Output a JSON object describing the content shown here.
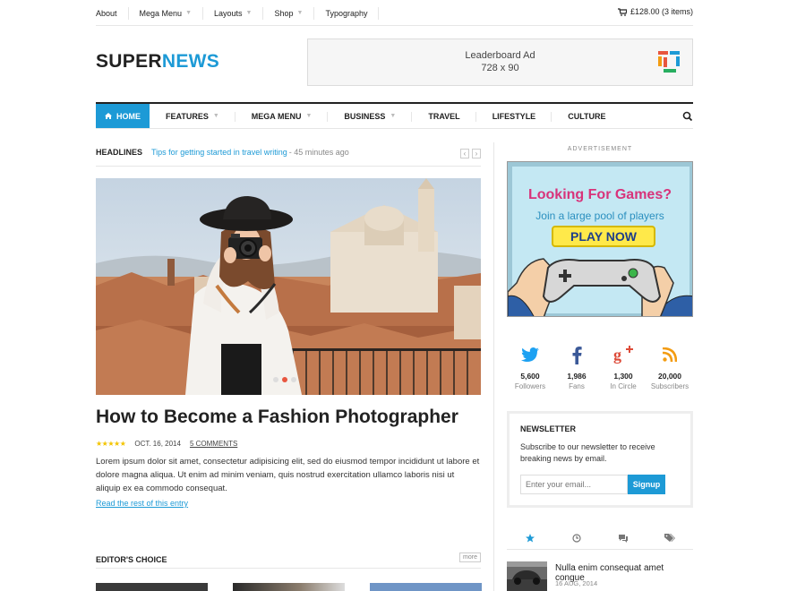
{
  "topbar": {
    "items": [
      {
        "label": "About",
        "dropdown": false
      },
      {
        "label": "Mega Menu",
        "dropdown": true
      },
      {
        "label": "Layouts",
        "dropdown": true
      },
      {
        "label": "Shop",
        "dropdown": true
      },
      {
        "label": "Typography",
        "dropdown": false
      }
    ],
    "cart": "£128.00 (3 items)"
  },
  "header": {
    "logo_part1": "SUPER",
    "logo_part2": "NEWS",
    "leaderboard_line1": "Leaderboard Ad",
    "leaderboard_line2": "728 x 90"
  },
  "nav": {
    "home": "HOME",
    "items": [
      {
        "label": "FEATURES",
        "dropdown": true
      },
      {
        "label": "MEGA MENU",
        "dropdown": true
      },
      {
        "label": "BUSINESS",
        "dropdown": true
      },
      {
        "label": "TRAVEL",
        "dropdown": false
      },
      {
        "label": "LIFESTYLE",
        "dropdown": false
      },
      {
        "label": "CULTURE",
        "dropdown": false
      }
    ]
  },
  "headlines": {
    "title": "HEADLINES",
    "link": "Tips for getting started in travel writing",
    "time": "- 45 minutes ago"
  },
  "article": {
    "title": "How to Become a Fashion Photographer",
    "rating": 5,
    "stars": "★★★★★",
    "date": "OCT. 16, 2014",
    "comments": "5 COMMENTS",
    "excerpt": "Lorem ipsum dolor sit amet, consectetur adipisicing elit, sed do eiusmod tempor incididunt ut labore et dolore magna aliqua. Ut enim ad minim veniam, quis nostrud exercitation ullamco laboris nisi ut aliquip ex ea commodo consequat.",
    "read_more": "Read the rest of this entry",
    "slide_active": 2
  },
  "editors_choice": {
    "title": "EDITOR'S CHOICE",
    "more": "more"
  },
  "sidebar": {
    "advert_label": "ADVERTISEMENT",
    "game_ad": {
      "headline": "Looking For Games?",
      "subline": "Join a large pool of players",
      "button": "PLAY NOW"
    },
    "social": [
      {
        "icon": "twitter-icon",
        "count": "5,600",
        "label": "Followers",
        "color": "#1da1f2"
      },
      {
        "icon": "facebook-icon",
        "count": "1,986",
        "label": "Fans",
        "color": "#3b5998"
      },
      {
        "icon": "googleplus-icon",
        "count": "1,300",
        "label": "In Circle",
        "color": "#dd4b39"
      },
      {
        "icon": "rss-icon",
        "count": "20,000",
        "label": "Subscribers",
        "color": "#f39c12"
      }
    ],
    "newsletter": {
      "title": "NEWSLETTER",
      "description": "Subscribe to our newsletter to receive breaking news by email.",
      "placeholder": "Enter your email...",
      "button": "Signup"
    },
    "post": {
      "title": "Nulla enim consequat amet congue",
      "date": "16 AUG, 2014"
    }
  },
  "colors": {
    "accent": "#1d9ad6",
    "dark": "#222222"
  }
}
